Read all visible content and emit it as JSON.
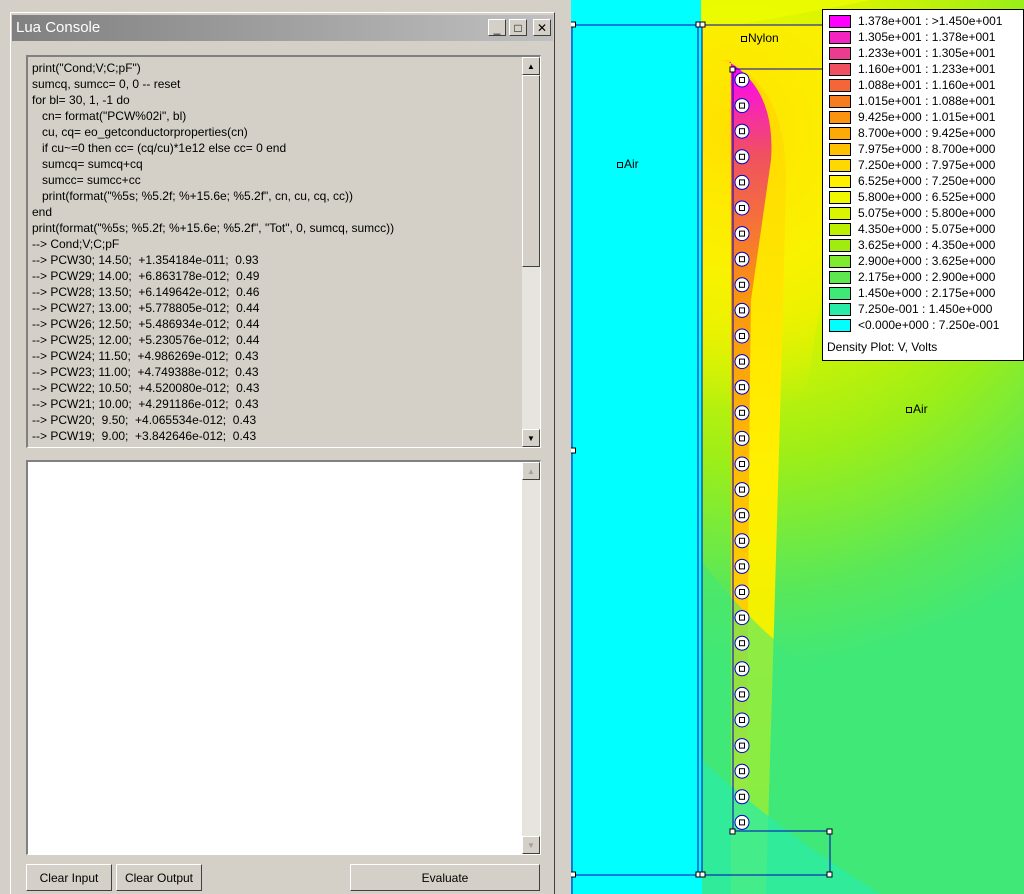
{
  "console": {
    "title": "Lua Console",
    "output_lines": [
      "print(\"Cond;V;C;pF\")",
      "sumcq, sumcc= 0, 0 -- reset",
      "for bl= 30, 1, -1 do",
      "   cn= format(\"PCW%02i\", bl)",
      "   cu, cq= eo_getconductorproperties(cn)",
      "   if cu~=0 then cc= (cq/cu)*1e12 else cc= 0 end",
      "   sumcq= sumcq+cq",
      "   sumcc= sumcc+cc",
      "   print(format(\"%5s; %5.2f; %+15.6e; %5.2f\", cn, cu, cq, cc))",
      "end",
      "print(format(\"%5s; %5.2f; %+15.6e; %5.2f\", \"Tot\", 0, sumcq, sumcc))",
      "--> Cond;V;C;pF",
      "--> PCW30; 14.50;  +1.354184e-011;  0.93",
      "--> PCW29; 14.00;  +6.863178e-012;  0.49",
      "--> PCW28; 13.50;  +6.149642e-012;  0.46",
      "--> PCW27; 13.00;  +5.778805e-012;  0.44",
      "--> PCW26; 12.50;  +5.486934e-012;  0.44",
      "--> PCW25; 12.00;  +5.230576e-012;  0.44",
      "--> PCW24; 11.50;  +4.986269e-012;  0.43",
      "--> PCW23; 11.00;  +4.749388e-012;  0.43",
      "--> PCW22; 10.50;  +4.520080e-012;  0.43",
      "--> PCW21; 10.00;  +4.291186e-012;  0.43",
      "--> PCW20;  9.50;  +4.065534e-012;  0.43",
      "--> PCW19;  9.00;  +3.842646e-012;  0.43"
    ],
    "input_value": "",
    "buttons": {
      "clear_input": "Clear Input",
      "clear_output": "Clear Output",
      "evaluate": "Evaluate"
    }
  },
  "legend": {
    "title": "Density Plot: V, Volts",
    "entries": [
      {
        "label": "1.378e+001 : >1.450e+001",
        "color": "#ff00ff"
      },
      {
        "label": "1.305e+001 : 1.378e+001",
        "color": "#f424c0"
      },
      {
        "label": "1.233e+001 : 1.305e+001",
        "color": "#ec3c90"
      },
      {
        "label": "1.160e+001 : 1.233e+001",
        "color": "#f05060"
      },
      {
        "label": "1.088e+001 : 1.160e+001",
        "color": "#f46638"
      },
      {
        "label": "1.015e+001 : 1.088e+001",
        "color": "#f77c20"
      },
      {
        "label": "9.425e+000 : 1.015e+001",
        "color": "#fa9410"
      },
      {
        "label": "8.700e+000 : 9.425e+000",
        "color": "#fcaa08"
      },
      {
        "label": "7.975e+000 : 8.700e+000",
        "color": "#fec000"
      },
      {
        "label": "7.250e+000 : 7.975e+000",
        "color": "#ffd800"
      },
      {
        "label": "6.525e+000 : 7.250e+000",
        "color": "#fff000"
      },
      {
        "label": "5.800e+000 : 6.525e+000",
        "color": "#f0f800"
      },
      {
        "label": "5.075e+000 : 5.800e+000",
        "color": "#d8f400"
      },
      {
        "label": "4.350e+000 : 5.075e+000",
        "color": "#bcf000"
      },
      {
        "label": "3.625e+000 : 4.350e+000",
        "color": "#a0ec10"
      },
      {
        "label": "2.900e+000 : 3.625e+000",
        "color": "#80ea30"
      },
      {
        "label": "2.175e+000 : 2.900e+000",
        "color": "#5ee850"
      },
      {
        "label": "1.450e+000 : 2.175e+000",
        "color": "#40e878"
      },
      {
        "label": "7.250e-001 : 1.450e+000",
        "color": "#28eca8"
      },
      {
        "label": "<0.000e+000 : 7.250e-001",
        "color": "#00ffff"
      }
    ]
  },
  "blocks": {
    "nylon": "Nylon",
    "air_left": "Air",
    "air_right": "Air"
  },
  "conductor_count": 30
}
